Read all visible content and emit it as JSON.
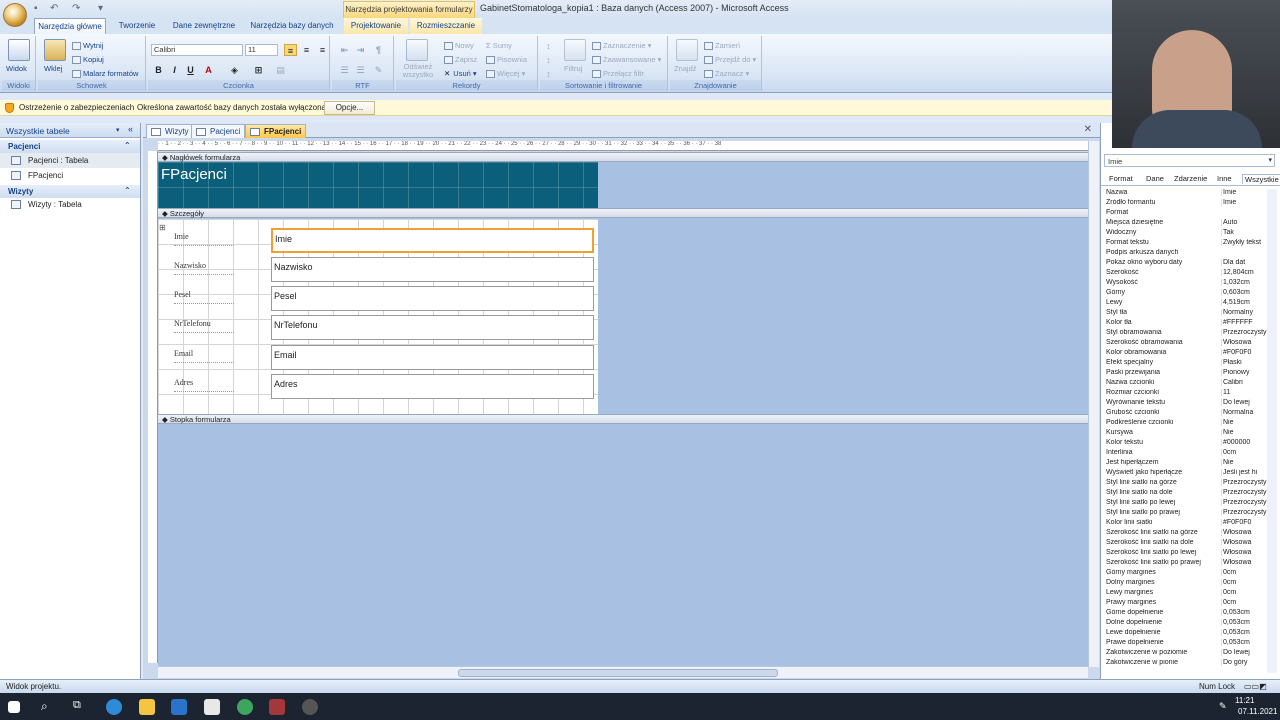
{
  "window": {
    "title": "GabinetStomatologa_kopia1 : Baza danych (Access 2007) - Microsoft Access",
    "context_tab_title": "Narzędzia projektowania formularzy"
  },
  "ribbon_tabs": [
    "Narzędzia główne",
    "Tworzenie",
    "Dane zewnętrzne",
    "Narzędzia bazy danych",
    "Projektowanie",
    "Rozmieszczanie"
  ],
  "ribbon": {
    "widok": {
      "button": "Widok",
      "label": "Widoki"
    },
    "schowek": {
      "wklej": "Wklej",
      "wytnij": "Wytnij",
      "kopiuj": "Kopiuj",
      "malarz": "Malarz formatów",
      "label": "Schowek"
    },
    "czcionka": {
      "font": "Calibri",
      "size": "11",
      "bold": "B",
      "italic": "I",
      "underline": "U",
      "color_a": "A",
      "label": "Czcionka"
    },
    "rtf": {
      "label": "RTF"
    },
    "rekordy": {
      "odswiez": "Odśwież wszystko",
      "nowy": "Nowy",
      "zapisz": "Zapisz",
      "usun": "Usuń",
      "sumy": "Sumy",
      "pisownia": "Pisownia",
      "wiecej": "Więcej",
      "label": "Rekordy"
    },
    "sortowanie": {
      "filtruj": "Filtruj",
      "zaznaczenie": "Zaznaczenie",
      "zaawansowane": "Zaawansowane",
      "przelacz": "Przełącz filtr",
      "label": "Sortowanie i filtrowanie"
    },
    "znajdowanie": {
      "znajdz": "Znajdź",
      "zamien": "Zamień",
      "przejdz": "Przejdź do",
      "zaznacz": "Zaznacz",
      "label": "Znajdowanie"
    }
  },
  "message_bar": {
    "title": "Ostrzeżenie o zabezpieczeniach",
    "text": "Określona zawartość bazy danych została wyłączona.",
    "options_button": "Opcje..."
  },
  "nav": {
    "header": "Wszystkie tabele",
    "groups": [
      {
        "name": "Pacjenci",
        "items": [
          "Pacjenci : Tabela",
          "FPacjenci"
        ]
      },
      {
        "name": "Wizyty",
        "items": [
          "Wizyty : Tabela"
        ]
      }
    ]
  },
  "doc_tabs": [
    "Wizyty",
    "Pacjenci",
    "FPacjenci"
  ],
  "design": {
    "ruler_text": "· · 1 · · 2 · · 3 · · 4 · · 5 · · 6 · · 7 · · 8 · · 9 · · 10 · · 11 · · 12 · · 13 · · 14 · · 15 · · 16 · · 17 · · 18 · · 19 · · 20 · · 21 · · 22 · · 23 · · 24 · · 25 · · 26 · · 27 · · 28 · · 29 · · 30 · · 31 · · 32 · · 33 · · 34 · · 35 · · 36 · · 37 · · 38",
    "header_section": "Nagłówek formularza",
    "detail_section": "Szczegóły",
    "footer_section": "Stopka formularza",
    "form_title": "FPacjenci",
    "labels": [
      "Imie",
      "Nazwisko",
      "Pesel",
      "NrTelefonu",
      "Email",
      "Adres"
    ],
    "fields": [
      "Imie",
      "Nazwisko",
      "Pesel",
      "NrTelefonu",
      "Email",
      "Adres"
    ]
  },
  "property_sheet": {
    "selected": "Imie",
    "tabs": [
      "Format",
      "Dane",
      "Zdarzenie",
      "Inne",
      "Wszystkie"
    ],
    "rows": [
      [
        "Nazwa",
        "Imie"
      ],
      [
        "Źródło formantu",
        "Imie"
      ],
      [
        "Format",
        ""
      ],
      [
        "Miejsca dziesiętne",
        "Auto"
      ],
      [
        "Widoczny",
        "Tak"
      ],
      [
        "Format tekstu",
        "Zwykły tekst"
      ],
      [
        "Podpis arkusza danych",
        ""
      ],
      [
        "Pokaż okno wyboru daty",
        "Dla dat"
      ],
      [
        "Szerokość",
        "12,804cm"
      ],
      [
        "Wysokość",
        "1,032cm"
      ],
      [
        "Górny",
        "0,603cm"
      ],
      [
        "Lewy",
        "4,519cm"
      ],
      [
        "Styl tła",
        "Normalny"
      ],
      [
        "Kolor tła",
        "#FFFFFF"
      ],
      [
        "Styl obramowania",
        "Przezroczysty"
      ],
      [
        "Szerokość obramowania",
        "Włosowa"
      ],
      [
        "Kolor obramowania",
        "#F0F0F0"
      ],
      [
        "Efekt specjalny",
        "Płaski"
      ],
      [
        "Paski przewijania",
        "Pionowy"
      ],
      [
        "Nazwa czcionki",
        "Calibri"
      ],
      [
        "Rozmiar czcionki",
        "11"
      ],
      [
        "Wyrównanie tekstu",
        "Do lewej"
      ],
      [
        "Grubość czcionki",
        "Normalna"
      ],
      [
        "Podkreślenie czcionki",
        "Nie"
      ],
      [
        "Kursywa",
        "Nie"
      ],
      [
        "Kolor tekstu",
        "#000000"
      ],
      [
        "Interlinia",
        "0cm"
      ],
      [
        "Jest hiperłączem",
        "Nie"
      ],
      [
        "Wyświetl jako hiperłącze",
        "Jeśli jest hi"
      ],
      [
        "Styl linii siatki na górze",
        "Przezroczysty"
      ],
      [
        "Styl linii siatki na dole",
        "Przezroczysty"
      ],
      [
        "Styl linii siatki po lewej",
        "Przezroczysty"
      ],
      [
        "Styl linii siatki po prawej",
        "Przezroczysty"
      ],
      [
        "Kolor linii siatki",
        "#F0F0F0"
      ],
      [
        "Szerokość linii siatki na górze",
        "Włosowa"
      ],
      [
        "Szerokość linii siatki na dole",
        "Włosowa"
      ],
      [
        "Szerokość linii siatki po lewej",
        "Włosowa"
      ],
      [
        "Szerokość linii siatki po prawej",
        "Włosowa"
      ],
      [
        "Górny margines",
        "0cm"
      ],
      [
        "Dolny margines",
        "0cm"
      ],
      [
        "Lewy margines",
        "0cm"
      ],
      [
        "Prawy margines",
        "0cm"
      ],
      [
        "Górne dopełnienie",
        "0,053cm"
      ],
      [
        "Dolne dopełnienie",
        "0,053cm"
      ],
      [
        "Lewe dopełnienie",
        "0,053cm"
      ],
      [
        "Prawe dopełnienie",
        "0,053cm"
      ],
      [
        "Zakotwiczenie w poziomie",
        "Do lewej"
      ],
      [
        "Zakotwiczenie w pionie",
        "Do góry"
      ]
    ]
  },
  "status": {
    "left": "Widok projektu.",
    "num_lock": "Num Lock"
  },
  "taskbar": {
    "time": "11:21",
    "date": "07.11.2021"
  }
}
